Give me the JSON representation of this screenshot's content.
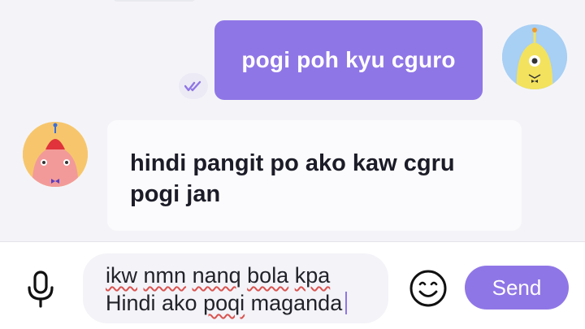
{
  "messages": {
    "outgoing_text": "pogi poh kyu cguro",
    "incoming_line1": "hindi pangit po ako kaw cgru",
    "incoming_line2": "pogi jan"
  },
  "composer": {
    "line1_words": [
      "ikw",
      "nmn",
      "nanq",
      "bola",
      "kpa"
    ],
    "line2_prefix": "Hindi ako ",
    "line2_misspelled": "poqi",
    "line2_suffix": " maganda",
    "send_label": "Send"
  },
  "icons": {
    "mic": "microphone-icon",
    "emoji": "smile-icon",
    "read_receipt": "double-check-icon"
  },
  "colors": {
    "accent": "#8f76e6",
    "spellcheck": "#d9534f"
  }
}
